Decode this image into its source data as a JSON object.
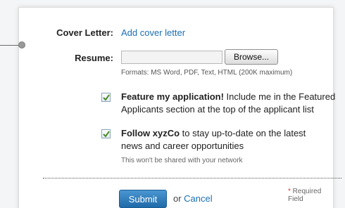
{
  "form": {
    "cover_letter": {
      "label": "Cover Letter:",
      "link": "Add cover letter"
    },
    "resume": {
      "label": "Resume:",
      "browse_label": "Browse...",
      "formats": "Formats: MS Word, PDF, Text, HTML (200K maximum)"
    },
    "feature_option": {
      "checked": true,
      "bold_text": "Feature my application!",
      "text": " Include me in the Featured Applicants section at the top of the applicant list"
    },
    "follow_option": {
      "checked": true,
      "bold_text": "Follow xyzCo",
      "text": " to stay up-to-date on the latest news and career opportunities"
    },
    "privacy_note": "This won't be shared with your network",
    "actions": {
      "submit_label": "Submit",
      "or_text": "or ",
      "cancel_label": "Cancel"
    },
    "required": {
      "star": "*",
      "text": " Required Field"
    }
  },
  "colors": {
    "link": "#1a6fb5",
    "submit": "#2a7bbd",
    "required_star": "#d43a2a",
    "checkmark": "#4a8a2a"
  }
}
